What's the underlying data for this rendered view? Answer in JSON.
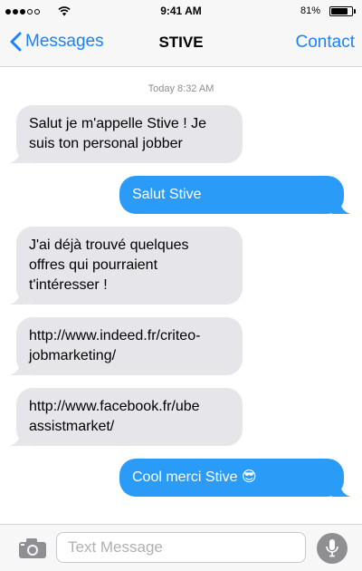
{
  "status_bar": {
    "time": "9:41 AM",
    "battery_percent_label": "81%",
    "battery_level": 0.81,
    "signal_bars_filled": 3,
    "signal_bars_total": 5
  },
  "nav": {
    "back_label": "Messages",
    "title": "STIVE",
    "contact_label": "Contact"
  },
  "conversation": {
    "timestamp": "Today 8:32 AM",
    "messages": [
      {
        "direction": "incoming",
        "lines": [
          "Salut je m'appelle Stive ! Je",
          "suis ton personal jobber"
        ]
      },
      {
        "direction": "outgoing",
        "lines": [
          "Salut Stive"
        ]
      },
      {
        "direction": "incoming",
        "lines": [
          "J'ai déjà trouvé quelques",
          "offres qui pourraient",
          "t'intéresser !"
        ]
      },
      {
        "direction": "incoming",
        "lines": [
          "http://www.indeed.fr/criteo-",
          "jobmarketing/"
        ]
      },
      {
        "direction": "incoming",
        "lines": [
          "http://www.facebook.fr/ube",
          "assistmarket/"
        ]
      },
      {
        "direction": "outgoing",
        "lines": [
          "Cool merci Stive 😎"
        ]
      }
    ]
  },
  "input_bar": {
    "placeholder": "Text Message",
    "value": ""
  },
  "colors": {
    "accent": "#1a82fb",
    "incoming_bubble": "#e5e5ea",
    "outgoing_bubble": "#2a9bf6"
  },
  "icons": {
    "back": "chevron-left-icon",
    "camera": "camera-icon",
    "mic": "microphone-icon",
    "wifi": "wifi-icon",
    "battery": "battery-icon",
    "signal": "signal-dots-icon"
  }
}
